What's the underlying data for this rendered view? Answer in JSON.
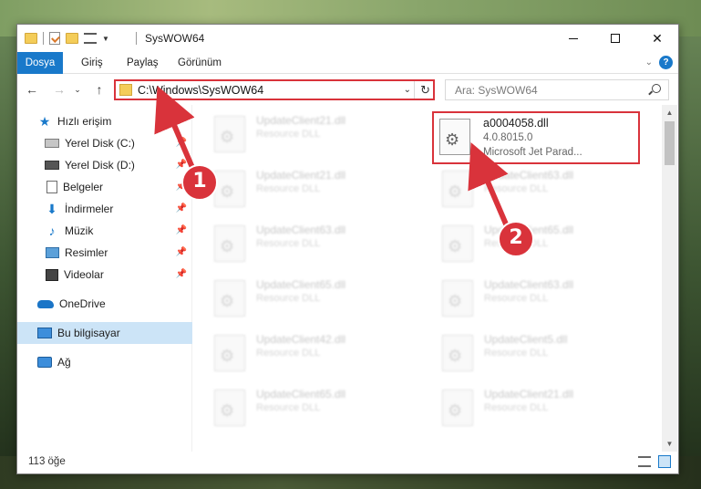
{
  "window": {
    "title": "SysWOW64",
    "controls": {
      "minimize": "min",
      "maximize": "max",
      "close": "✕"
    }
  },
  "ribbon": {
    "tabs": [
      "Dosya",
      "Giriş",
      "Paylaş",
      "Görünüm"
    ],
    "help": "?"
  },
  "navbar": {
    "address": "C:\\Windows\\SysWOW64",
    "search_placeholder": "Ara: SysWOW64"
  },
  "sidebar": {
    "items": [
      {
        "label": "Hızlı erişim",
        "icon": "star-icon",
        "pinned": false
      },
      {
        "label": "Yerel Disk (C:)",
        "icon": "drive-icon",
        "pinned": true
      },
      {
        "label": "Yerel Disk (D:)",
        "icon": "drive-icon",
        "pinned": true
      },
      {
        "label": "Belgeler",
        "icon": "documents-icon",
        "pinned": true
      },
      {
        "label": "İndirmeler",
        "icon": "download-icon",
        "pinned": true
      },
      {
        "label": "Müzik",
        "icon": "music-icon",
        "pinned": true
      },
      {
        "label": "Resimler",
        "icon": "pictures-icon",
        "pinned": true
      },
      {
        "label": "Videolar",
        "icon": "video-icon",
        "pinned": true
      },
      {
        "label": "OneDrive",
        "icon": "onedrive-icon",
        "pinned": false
      },
      {
        "label": "Bu bilgisayar",
        "icon": "computer-icon",
        "pinned": false,
        "selected": true
      },
      {
        "label": "Ağ",
        "icon": "network-icon",
        "pinned": false
      }
    ]
  },
  "files": {
    "left": [
      {
        "name": "UpdateClient21.dll",
        "desc": "Resource DLL"
      },
      {
        "name": "UpdateClient21.dll",
        "desc": "Resource DLL"
      },
      {
        "name": "UpdateClient63.dll",
        "desc": "Resource DLL"
      },
      {
        "name": "UpdateClient65.dll",
        "desc": "Resource DLL"
      },
      {
        "name": "UpdateClient42.dll",
        "desc": "Resource DLL"
      },
      {
        "name": "UpdateClient65.dll",
        "desc": "Resource DLL"
      }
    ],
    "right_highlight": {
      "name": "a0004058.dll",
      "version": "4.0.8015.0",
      "desc": "Microsoft Jet Parad..."
    },
    "right": [
      {
        "name": "UpdateClient63.dll",
        "desc": "Resource DLL"
      },
      {
        "name": "UpdateClient65.dll",
        "desc": "Resource DLL"
      },
      {
        "name": "UpdateClient63.dll",
        "desc": "Resource DLL"
      },
      {
        "name": "UpdateClient5.dll",
        "desc": "Resource DLL"
      },
      {
        "name": "UpdateClient21.dll",
        "desc": "Resource DLL"
      }
    ]
  },
  "status": {
    "count": "113 öğe"
  },
  "annotations": {
    "step1": "1",
    "step2": "2",
    "color": "#d9333b"
  }
}
